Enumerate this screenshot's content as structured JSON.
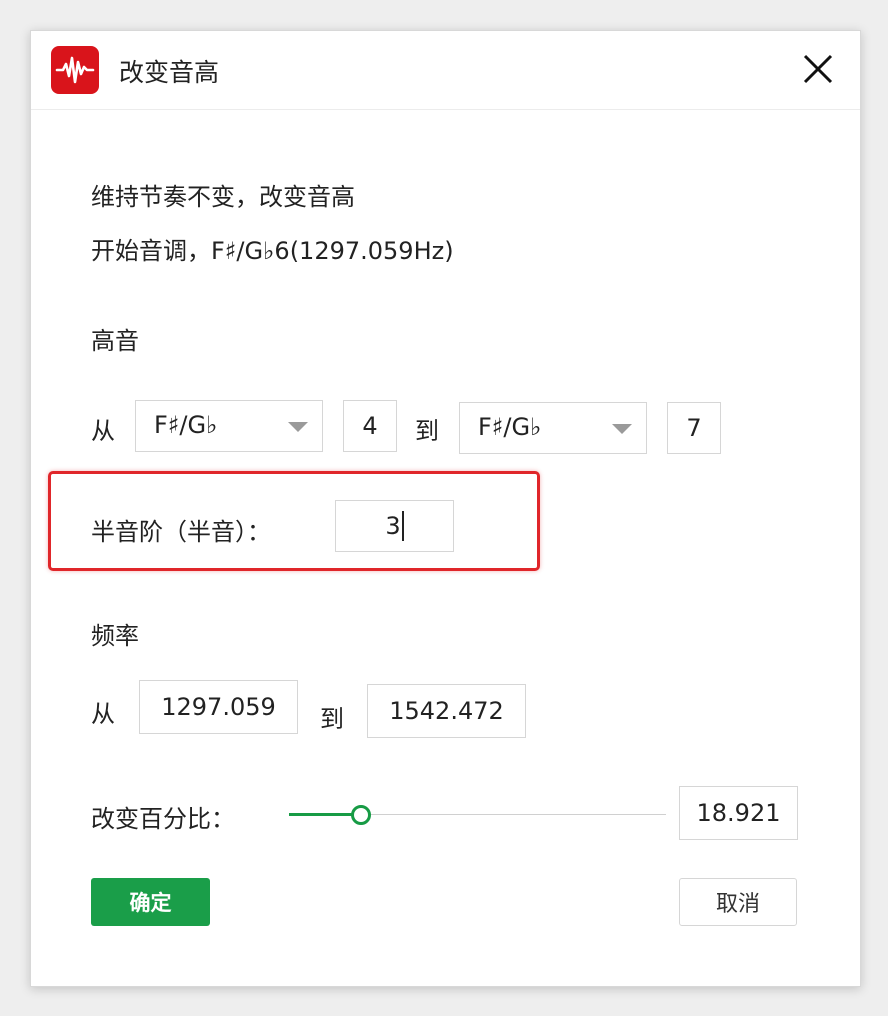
{
  "window": {
    "title": "改变音高",
    "app_icon": "waveform-icon",
    "close_icon": "close-icon"
  },
  "description": {
    "line1": "维持节奏不变，改变音高",
    "line2": "开始音调，F♯/G♭6(1297.059Hz)"
  },
  "pitch": {
    "heading": "高音",
    "from_label": "从",
    "from_note": "F♯/G♭",
    "from_octave": "4",
    "to_label": "到",
    "to_note": "F♯/G♭",
    "to_octave": "7"
  },
  "semitone": {
    "label": "半音阶（半音）：",
    "value": "3"
  },
  "frequency": {
    "heading": "频率",
    "from_label": "从",
    "from_value": "1297.059",
    "to_label": "到",
    "to_value": "1542.472"
  },
  "percent": {
    "label": "改变百分比：",
    "value": "18.921",
    "slider_fraction": 0.19
  },
  "buttons": {
    "ok": "确定",
    "cancel": "取消"
  },
  "colors": {
    "accent": "#1a9e49",
    "highlight": "#e0262a",
    "app_icon_bg": "#d9141b"
  }
}
